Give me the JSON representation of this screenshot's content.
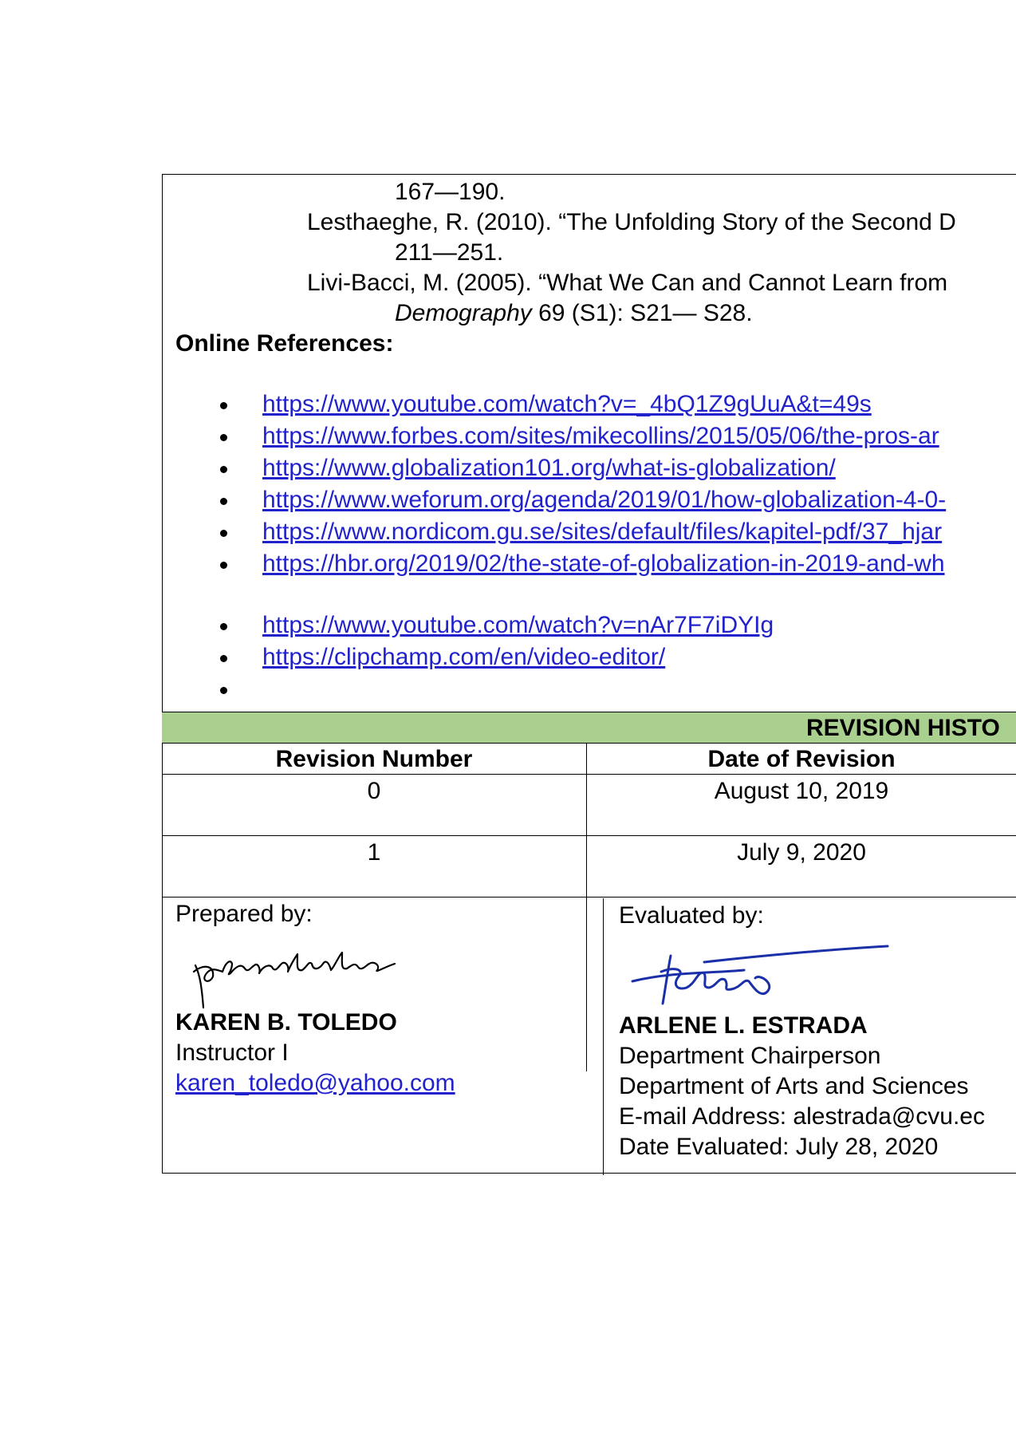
{
  "references": {
    "line1": "167—190.",
    "line2": "Lesthaeghe, R. (2010). “The Unfolding Story of the Second D",
    "line3": "211—251.",
    "line4": "Livi-Bacci, M. (2005). “What We Can and Cannot Learn from",
    "line5_italic": "Demography",
    "line5_rest": " 69 (S1): S21— S28."
  },
  "online": {
    "heading": "Online References:",
    "links": [
      "https://www.youtube.com/watch?v=_4bQ1Z9gUuA&t=49s",
      "https://www.forbes.com/sites/mikecollins/2015/05/06/the-pros-ar",
      "https://www.globalization101.org/what-is-globalization/",
      "https://www.weforum.org/agenda/2019/01/how-globalization-4-0-",
      "https://www.nordicom.gu.se/sites/default/files/kapitel-pdf/37_hjar",
      "https://hbr.org/2019/02/the-state-of-globalization-in-2019-and-wh",
      "https://www.youtube.com/watch?v=nAr7F7iDYIg",
      "https://clipchamp.com/en/video-editor/"
    ]
  },
  "revision": {
    "title": "REVISION HISTO",
    "col1": "Revision Number",
    "col2": "Date of Revision",
    "rows": [
      {
        "number": "0",
        "date": "August 10, 2019"
      },
      {
        "number": "1",
        "date": "July 9, 2020"
      }
    ],
    "band_color": "#a9d08e"
  },
  "prepared": {
    "label": "Prepared by:",
    "name": "KAREN B. TOLEDO",
    "title": "Instructor I",
    "email": "karen_toledo@yahoo.com"
  },
  "evaluated": {
    "label": "Evaluated by:",
    "name": "ARLENE L. ESTRADA",
    "title": "Department Chairperson",
    "dept": "Department of Arts and Sciences",
    "email": "E-mail Address: alestrada@cvu.ec",
    "date": "Date Evaluated: July 28, 2020"
  }
}
